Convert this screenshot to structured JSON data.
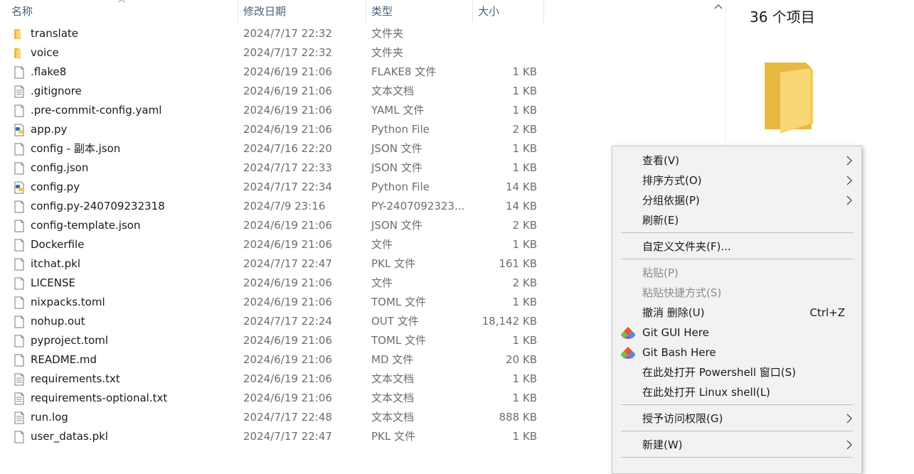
{
  "header": {
    "name": "名称",
    "date": "修改日期",
    "type": "类型",
    "size": "大小"
  },
  "files": [
    {
      "name": "translate",
      "date": "2024/7/17 22:32",
      "type": "文件夹",
      "size": "",
      "icon": "folder"
    },
    {
      "name": "voice",
      "date": "2024/7/17 22:32",
      "type": "文件夹",
      "size": "",
      "icon": "folder"
    },
    {
      "name": ".flake8",
      "date": "2024/6/19 21:06",
      "type": "FLAKE8 文件",
      "size": "1 KB",
      "icon": "file"
    },
    {
      "name": ".gitignore",
      "date": "2024/6/19 21:06",
      "type": "文本文档",
      "size": "1 KB",
      "icon": "text"
    },
    {
      "name": ".pre-commit-config.yaml",
      "date": "2024/6/19 21:06",
      "type": "YAML 文件",
      "size": "1 KB",
      "icon": "file"
    },
    {
      "name": "app.py",
      "date": "2024/6/19 21:06",
      "type": "Python File",
      "size": "2 KB",
      "icon": "python"
    },
    {
      "name": "config - 副本.json",
      "date": "2024/7/16 22:20",
      "type": "JSON 文件",
      "size": "1 KB",
      "icon": "file"
    },
    {
      "name": "config.json",
      "date": "2024/7/17 22:33",
      "type": "JSON 文件",
      "size": "1 KB",
      "icon": "file"
    },
    {
      "name": "config.py",
      "date": "2024/7/17 22:34",
      "type": "Python File",
      "size": "14 KB",
      "icon": "python"
    },
    {
      "name": "config.py-240709232318",
      "date": "2024/7/9 23:16",
      "type": "PY-2407092323...",
      "size": "14 KB",
      "icon": "file"
    },
    {
      "name": "config-template.json",
      "date": "2024/6/19 21:06",
      "type": "JSON 文件",
      "size": "2 KB",
      "icon": "file"
    },
    {
      "name": "Dockerfile",
      "date": "2024/6/19 21:06",
      "type": "文件",
      "size": "1 KB",
      "icon": "file"
    },
    {
      "name": "itchat.pkl",
      "date": "2024/7/17 22:47",
      "type": "PKL 文件",
      "size": "161 KB",
      "icon": "file"
    },
    {
      "name": "LICENSE",
      "date": "2024/6/19 21:06",
      "type": "文件",
      "size": "2 KB",
      "icon": "file"
    },
    {
      "name": "nixpacks.toml",
      "date": "2024/6/19 21:06",
      "type": "TOML 文件",
      "size": "1 KB",
      "icon": "file"
    },
    {
      "name": "nohup.out",
      "date": "2024/7/17 22:24",
      "type": "OUT 文件",
      "size": "18,142 KB",
      "icon": "file"
    },
    {
      "name": "pyproject.toml",
      "date": "2024/6/19 21:06",
      "type": "TOML 文件",
      "size": "1 KB",
      "icon": "file"
    },
    {
      "name": "README.md",
      "date": "2024/6/19 21:06",
      "type": "MD 文件",
      "size": "20 KB",
      "icon": "file"
    },
    {
      "name": "requirements.txt",
      "date": "2024/6/19 21:06",
      "type": "文本文档",
      "size": "1 KB",
      "icon": "text"
    },
    {
      "name": "requirements-optional.txt",
      "date": "2024/6/19 21:06",
      "type": "文本文档",
      "size": "1 KB",
      "icon": "text"
    },
    {
      "name": "run.log",
      "date": "2024/7/17 22:48",
      "type": "文本文档",
      "size": "888 KB",
      "icon": "text"
    },
    {
      "name": "user_datas.pkl",
      "date": "2024/7/17 22:47",
      "type": "PKL 文件",
      "size": "1 KB",
      "icon": "file"
    }
  ],
  "preview": {
    "item_count": "36 个项目"
  },
  "context_menu": {
    "view": "查看(V)",
    "sort": "排序方式(O)",
    "group": "分组依据(P)",
    "refresh": "刷新(E)",
    "customize": "自定义文件夹(F)...",
    "paste": "粘贴(P)",
    "paste_shortcut": "粘贴快捷方式(S)",
    "undo_delete": "撤消 删除(U)",
    "undo_shortcut": "Ctrl+Z",
    "git_gui": "Git GUI Here",
    "git_bash": "Git Bash Here",
    "powershell": "在此处打开 Powershell 窗口(S)",
    "linux_shell": "在此处打开 Linux shell(L)",
    "grant_access": "授予访问权限(G)",
    "new": "新建(W)"
  },
  "colors": {
    "folder": "#f8d775",
    "folder_dark": "#e8b941",
    "menu_bg": "#f2f2f2",
    "header_text": "#4c607a",
    "secondary_text": "#6d6d6d"
  }
}
